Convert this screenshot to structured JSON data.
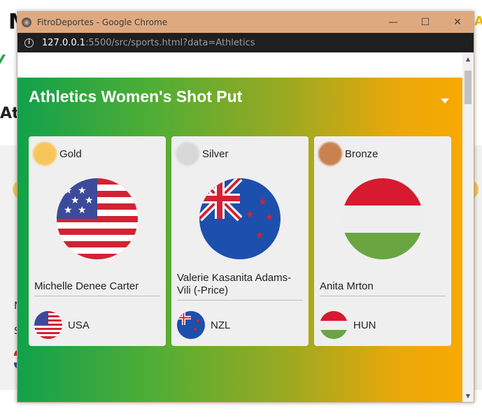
{
  "background": {
    "title_fragment": "M",
    "title_fragment_right": "A",
    "heading_fragment": "At",
    "letters": [
      "N",
      "S"
    ]
  },
  "window": {
    "title": "FitroDeportes - Google Chrome",
    "controls": {
      "minimize": "—",
      "maximize": "☐",
      "close": "✕"
    },
    "url_host": "127.0.0.1",
    "url_rest": ":5500/src/sports.html?data=Athletics",
    "info_icon": "i"
  },
  "panel": {
    "title": "Athletics Women's Shot Put",
    "colors": {
      "gradient_start": "#12a14a",
      "gradient_end": "#f8a900"
    }
  },
  "medalists": [
    {
      "medal": "Gold",
      "medal_color": "#f6c65a",
      "athlete": "Michelle Denee Carter",
      "country": "USA",
      "flag": "usa-flag"
    },
    {
      "medal": "Silver",
      "medal_color": "#d8d8d8",
      "athlete": "Valerie Kasanita Adams-Vili (-Price)",
      "country": "NZL",
      "flag": "nzl-flag"
    },
    {
      "medal": "Bronze",
      "medal_color": "#c98150",
      "athlete": "Anita Mrton",
      "country": "HUN",
      "flag": "hun-flag"
    }
  ]
}
